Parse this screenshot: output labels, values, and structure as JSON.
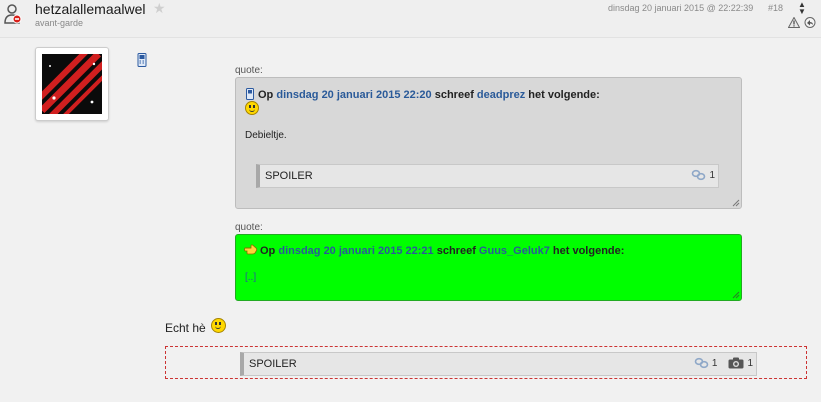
{
  "header": {
    "username": "hetzalallemaalwel",
    "user_title": "avant-garde",
    "date": "dinsdag 20 januari 2015 @ 22:22:39",
    "post_number": "#18"
  },
  "quotes": [
    {
      "label": "quote:",
      "prefix": "Op",
      "date": "dinsdag 20 januari 2015 22:20",
      "wrote": "schreef",
      "author": "deadprez",
      "suffix": "het volgende:",
      "body": "Debieltje.",
      "spoiler": {
        "label": "SPOILER",
        "link_count": "1"
      },
      "bg_color": "#d8d8d8"
    },
    {
      "label": "quote:",
      "prefix": "Op",
      "date": "dinsdag 20 januari 2015 22:21",
      "wrote": "schreef",
      "author": "Guus_Geluk7",
      "suffix": "het volgende:",
      "body": "[..]",
      "bg_color": "#00ff00"
    }
  ],
  "reply": {
    "text": "Echt hè",
    "spoiler": {
      "label": "SPOILER",
      "link_count": "1",
      "image_count": "1"
    }
  },
  "icons": {
    "status": "user-offline-icon",
    "star": "star-icon",
    "mobile": "mobile-phone-icon",
    "hand": "pointing-hand-icon",
    "report": "warning-triangle-icon",
    "quote": "quote-reply-icon",
    "link": "link-icon",
    "camera": "camera-icon"
  }
}
